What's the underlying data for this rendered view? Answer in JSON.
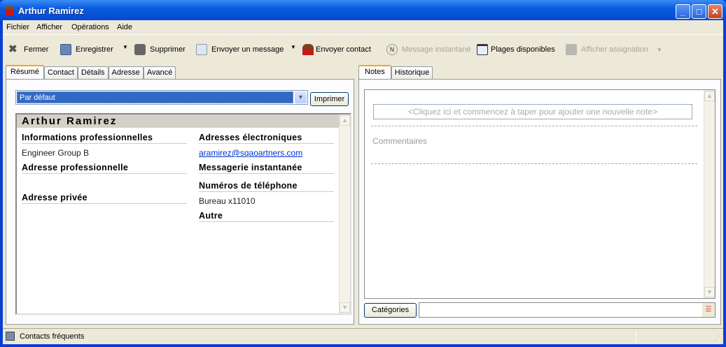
{
  "window": {
    "title": "Arthur Ramirez"
  },
  "menu": [
    "Fichier",
    "Afficher",
    "Opérations",
    "Aide"
  ],
  "toolbar": {
    "close": "Fermer",
    "save": "Enregistrer",
    "delete": "Supprimer",
    "send_message": "Envoyer un message",
    "send_contact": "Envoyer contact",
    "instant_message": "Message instantané",
    "availability": "Plages disponibles",
    "show_assignment": "Afficher assignation"
  },
  "left_tabs": [
    "Résumé",
    "Contact",
    "Détails",
    "Adresse",
    "Avancé"
  ],
  "view_select": {
    "value": "Par défaut"
  },
  "print_label": "Imprimer",
  "summary": {
    "name": "Arthur Ramirez",
    "business_info": "Informations professionnelles",
    "company": "Engineer Group B",
    "business_address": "Adresse professionnelle",
    "home_address": "Adresse privée",
    "emails": "Adresses électroniques",
    "email": "aramirez@sqaoartners.com",
    "im": "Messagerie instantanée",
    "phones": "Numéros de téléphone",
    "phone": "Bureau x11010",
    "other": "Autre"
  },
  "right_tabs": [
    "Notes",
    "Historique"
  ],
  "notes": {
    "placeholder": "<Cliquez ici et commencez à taper pour ajouter une nouvelle note>",
    "comments": "Commentaires"
  },
  "categories_label": "Catégories",
  "categories_value": "",
  "status": {
    "text": "Contacts fréquents"
  }
}
